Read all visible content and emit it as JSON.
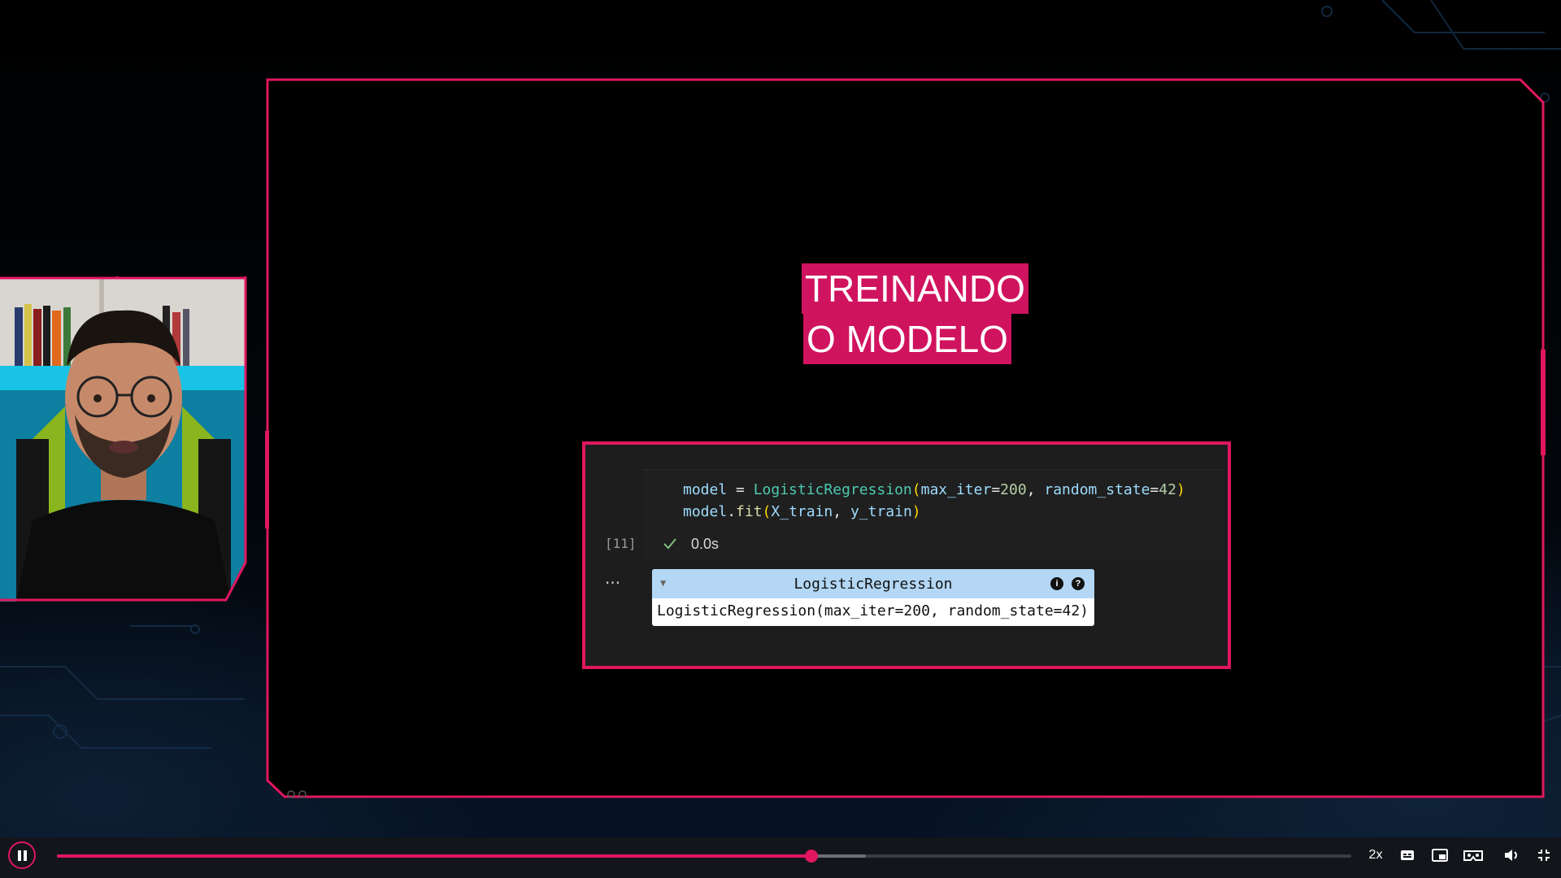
{
  "slide": {
    "title_line1": "TREINANDO",
    "title_line2": "O MODELO",
    "accent_color": "#e0175f"
  },
  "notebook_cell": {
    "code_lines": [
      "model = LogisticRegression(max_iter=200, random_state=42)",
      "model.fit(X_train, y_train)"
    ],
    "execution_count": "[11]",
    "status_icon": "check-icon",
    "execution_time": "0.0s",
    "output_marker": "...",
    "output_widget": {
      "header_label": "LogisticRegression",
      "header_icons": [
        "info-icon",
        "help-icon"
      ],
      "body_text": "LogisticRegression(max_iter=200, random_state=42)"
    }
  },
  "player": {
    "progress_fraction": 0.583,
    "buffered_fraction": 0.625,
    "playback_speed": "2x",
    "controls": [
      "pause-icon",
      "subtitles-icon",
      "picture-in-picture-icon",
      "vr-headset-icon",
      "volume-icon",
      "fullscreen-exit-icon"
    ]
  }
}
